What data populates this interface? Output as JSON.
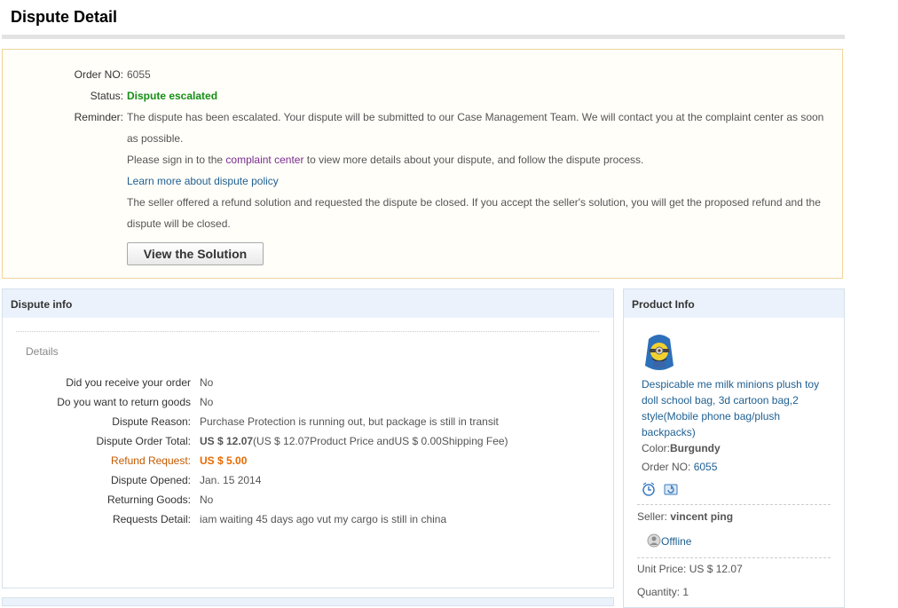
{
  "page_title": "Dispute Detail",
  "status_box": {
    "order_no_label": "Order NO:",
    "order_no_value": "6055",
    "status_label": "Status:",
    "status_value": "Dispute escalated",
    "reminder_label": "Reminder:",
    "reminder_text": "The dispute has been escalated. Your dispute will be submitted to our Case Management Team. We will contact you at the complaint center as soon as possible.",
    "signin_before": "Please sign in to the ",
    "signin_link": "complaint center",
    "signin_after": " to view more details about your dispute, and follow the dispute process.",
    "policy_link": "Learn more about dispute policy",
    "seller_offer_text": "The seller offered a refund solution and requested the dispute be closed. If you accept the seller's solution, you will get the proposed refund and the dispute will be closed.",
    "view_solution_button": "View the Solution"
  },
  "dispute_info": {
    "header": "Dispute info",
    "details_label": "Details",
    "rows": [
      {
        "label": "Did you receive your order",
        "value": "No"
      },
      {
        "label": "Do you want to return goods",
        "value": "No"
      },
      {
        "label": "Dispute Reason:",
        "value": "Purchase Protection is running out, but package is still in transit"
      },
      {
        "label": "Dispute Order Total:",
        "value_bold": "US $ 12.07",
        "value": "(US $ 12.07Product Price andUS $ 0.00Shipping Fee)"
      },
      {
        "label": "Refund Request:",
        "value": "US $ 5.00"
      },
      {
        "label": "Dispute Opened:",
        "value": "Jan. 15 2014"
      },
      {
        "label": "Returning Goods:",
        "value": "No"
      },
      {
        "label": "Requests Detail:",
        "value": "iam waiting 45 days ago vut my cargo is still in china"
      }
    ]
  },
  "product_info": {
    "header": "Product Info",
    "title": "Despicable me milk minions plush toy doll school bag, 3d cartoon bag,2 style(Mobile phone bag/plush backpacks)",
    "color_label": "Color:",
    "color_value": "Burgundy",
    "order_no_label": "Order NO:",
    "order_no_value": "6055",
    "seller_label": "Seller:",
    "seller_name": "vincent ping",
    "online_status": "Offline",
    "unit_price_label": "Unit Price:",
    "unit_price_value": "US $ 12.07",
    "quantity_label": "Quantity:",
    "quantity_value": "1"
  },
  "icons": [
    "clock-icon",
    "refresh-icon",
    "user-status-icon",
    "product-thumbnail"
  ],
  "colors": {
    "status_green": "#168f16",
    "refund_orange": "#e86a00",
    "link_blue": "#1f5f91",
    "panel_header": "#ebf2fb",
    "notice_border": "#f0d59b"
  }
}
